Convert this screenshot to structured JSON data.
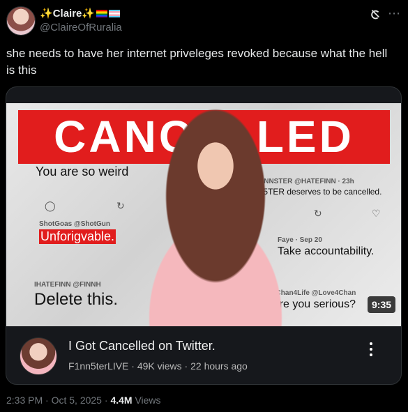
{
  "tweet": {
    "display_name": "Claire",
    "handle": "@ClaireOfRuralia",
    "text": "she needs to have her internet priveleges revoked because what the hell is this",
    "time": "2:33 PM",
    "date": "Oct 5, 2025",
    "views": "4.4M",
    "views_label": "Views"
  },
  "thumbnail": {
    "banner": "CANCELLED",
    "comments": [
      {
        "name": "",
        "text": "You are so weird"
      },
      {
        "name": "ANTIFINNSTER @HATEFINN · 23h",
        "text": "F1NN5TER deserves to be cancelled."
      },
      {
        "name": "ShotGoas @ShotGun",
        "text": "Unforigvable."
      },
      {
        "name": "Faye · Sep 20",
        "text": "Take accountability."
      },
      {
        "name": "IHATEFINN @FINNH",
        "text": "Delete this."
      },
      {
        "name": "4Chan4Life @Love4Chan",
        "text": "Are you serious?"
      }
    ],
    "duration": "9:35"
  },
  "video": {
    "title": "I Got Cancelled on Twitter.",
    "channel": "F1nn5terLIVE",
    "views": "49K views",
    "age": "22 hours ago"
  },
  "icons": {
    "grok": "grok-icon",
    "more": "more-icon",
    "video_menu": "video-menu-icon"
  }
}
